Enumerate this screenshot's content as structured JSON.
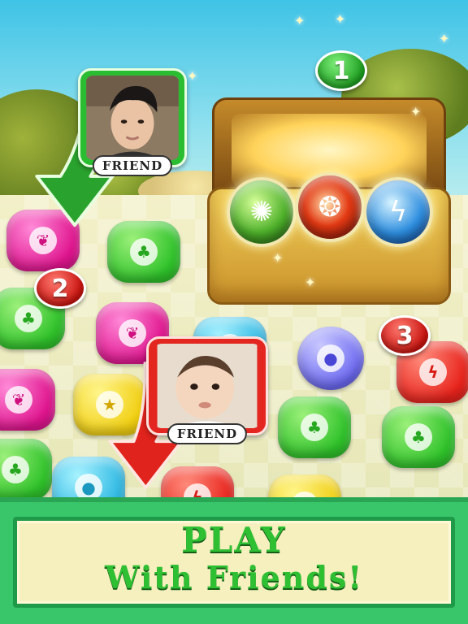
{
  "game": {
    "friend_label_1": "FRIEND",
    "friend_label_2": "FRIEND",
    "step_1": "1",
    "step_2": "2",
    "step_3": "3",
    "banner_line1": "PLAY",
    "banner_line2": "With Friends!"
  },
  "icons": {
    "gem_symbols": [
      "leaf-icon",
      "flame-icon",
      "water-drop-icon",
      "lightning-icon",
      "star-icon"
    ],
    "chest_orbs": [
      "green-swirl-orb",
      "red-fire-orb",
      "blue-lightning-orb"
    ]
  },
  "colors": {
    "banner_green": "#39c66a",
    "banner_text": "#2fbf33",
    "panel_bg": "#f6efbe",
    "friend1_frame": "#2bbd31",
    "friend2_frame": "#e3261f"
  }
}
